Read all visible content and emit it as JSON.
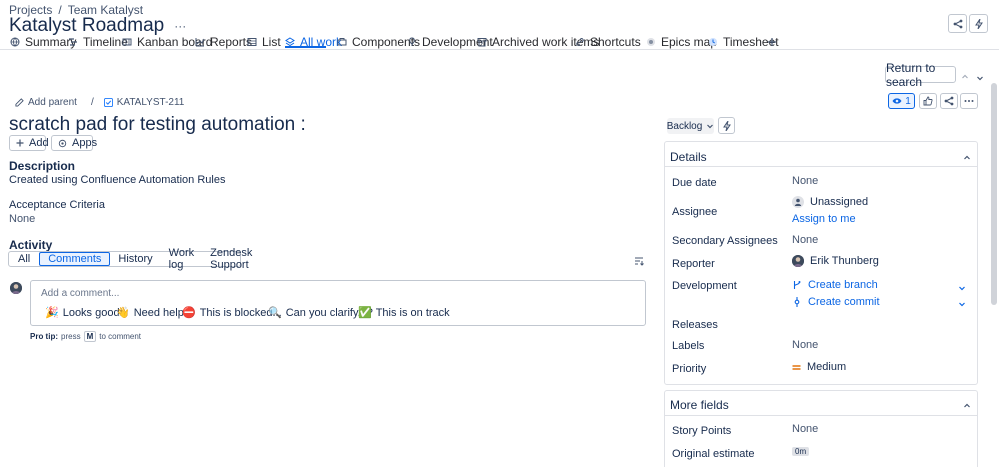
{
  "breadcrumb": {
    "projects": "Projects",
    "separator": "/",
    "team": "Team Katalyst"
  },
  "project": {
    "title": "Katalyst Roadmap",
    "more": "···"
  },
  "tabs": [
    {
      "label": "Summary",
      "icon": "globe-icon"
    },
    {
      "label": "Timeline",
      "icon": "timeline-icon"
    },
    {
      "label": "Kanban board",
      "icon": "board-icon"
    },
    {
      "label": "Reports",
      "icon": "chart-icon"
    },
    {
      "label": "List",
      "icon": "list-icon"
    },
    {
      "label": "All work",
      "icon": "layers-icon",
      "active": true
    },
    {
      "label": "Components",
      "icon": "component-icon"
    },
    {
      "label": "Development",
      "icon": "branch-icon"
    },
    {
      "label": "Archived work items",
      "icon": "archive-icon"
    },
    {
      "label": "Shortcuts",
      "icon": "link-icon"
    },
    {
      "label": "Epics map",
      "icon": "map-icon"
    },
    {
      "label": "Timesheet",
      "icon": "clock-icon"
    }
  ],
  "nav": {
    "return_to_search": "Return to search"
  },
  "issue": {
    "add_parent": "Add parent",
    "separator": "/",
    "key": "KATALYST-211",
    "title": "scratch pad for testing automation :",
    "add_label": "Add",
    "apps_label": "Apps",
    "watch_count": "1",
    "description_heading": "Description",
    "description": "Created using Confluence Automation Rules",
    "acceptance_heading": "Acceptance Criteria",
    "acceptance_value": "None"
  },
  "activity": {
    "heading": "Activity",
    "tabs": [
      "All",
      "Comments",
      "History",
      "Work log",
      "Zendesk Support"
    ],
    "selected": "Comments",
    "comment_placeholder": "Add a comment...",
    "quick_replies": [
      {
        "emoji": "🎉",
        "label": "Looks good!"
      },
      {
        "emoji": "👋",
        "label": "Need help?"
      },
      {
        "emoji": "⛔",
        "label": "This is blocked..."
      },
      {
        "emoji": "🔍",
        "label": "Can you clarify...?"
      },
      {
        "emoji": "✅",
        "label": "This is on track"
      }
    ],
    "pro_tip_bold": "Pro tip:",
    "pro_tip_press": "press",
    "pro_tip_key": "M",
    "pro_tip_rest": "to comment"
  },
  "status": {
    "label": "Backlog"
  },
  "details": {
    "heading": "Details",
    "fields": {
      "due_date": {
        "label": "Due date",
        "value": "None"
      },
      "assignee": {
        "label": "Assignee",
        "value": "Unassigned",
        "action": "Assign to me"
      },
      "secondary_assignees": {
        "label": "Secondary Assignees",
        "value": "None"
      },
      "reporter": {
        "label": "Reporter",
        "value": "Erik Thunberg"
      },
      "development": {
        "label": "Development",
        "create_branch": "Create branch",
        "create_commit": "Create commit"
      },
      "releases": {
        "label": "Releases"
      },
      "labels": {
        "label": "Labels",
        "value": "None"
      },
      "priority": {
        "label": "Priority",
        "value": "Medium",
        "color": "#e2740d"
      }
    }
  },
  "more_fields": {
    "heading": "More fields",
    "story_points": {
      "label": "Story Points",
      "value": "None"
    },
    "original_estimate": {
      "label": "Original estimate",
      "value": "0m"
    }
  },
  "colors": {
    "accent": "#0c66e4",
    "text": "#172b4d",
    "border": "#c1c7d0"
  }
}
